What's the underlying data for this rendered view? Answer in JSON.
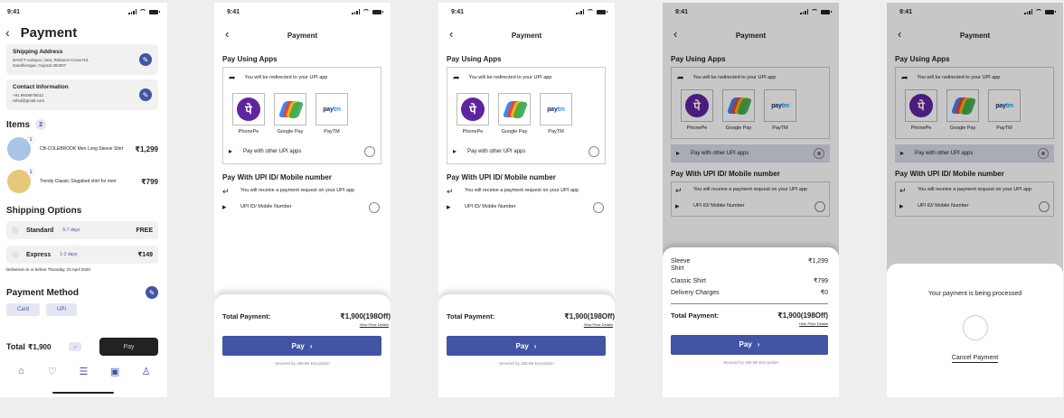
{
  "status_time": "9:41",
  "checkout": {
    "title": "Payment",
    "shipping_address": {
      "title": "Shipping Address",
      "line1": "DAIICT-campus, near, Reliance Cross Rd,",
      "line2": "Gandhinagar, Gujarat 382007"
    },
    "contact": {
      "title": "Contact Information",
      "phone": "+91 9648875612",
      "email": "rahul@gmail.com"
    },
    "items_label": "Items",
    "items_count": "2",
    "items": [
      {
        "qty": "1",
        "name": "CB-COLEBROOK Men Long Sleeve Shirt",
        "price": "₹1,299",
        "color": "#a9c4e4"
      },
      {
        "qty": "1",
        "name": "Trendy Classic Slugabed shirt for men",
        "price": "₹799",
        "color": "#e7c77a"
      }
    ],
    "shipping_label": "Shipping Options",
    "shipping_options": [
      {
        "name": "Standard",
        "days": "5-7 days",
        "price": "FREE"
      },
      {
        "name": "Express",
        "days": "1-2 days",
        "price": "₹149"
      }
    ],
    "delivery_note": "Delivered on or before Thursday, 23 April 2020",
    "payment_method_label": "Payment Method",
    "methods": [
      "Card",
      "UPI"
    ],
    "total_label": "Total",
    "total_value": "₹1,900",
    "pay_label": "Pay",
    "tabs": [
      "home-icon",
      "heart-icon",
      "list-icon",
      "bag-icon",
      "profile-icon"
    ]
  },
  "upi": {
    "title": "Payment",
    "pay_using_apps": "Pay Using Apps",
    "redirect_text": "You will be redirected to your UPI app",
    "apps": [
      {
        "name": "PhonePe",
        "icon": "phonepe-icon"
      },
      {
        "name": "Google Pay",
        "icon": "googlepay-icon"
      },
      {
        "name": "PayTM",
        "icon": "paytm-icon"
      }
    ],
    "paytm_logo_a": "pay",
    "paytm_logo_b": "tm",
    "phonepe_glyph": "पे",
    "other_apps": "Pay with other UPI apps",
    "upi_section": "Pay With UPI ID/ Mobile number",
    "upi_request": "You will receive a payment request on your UPI app",
    "upi_field": "UPI ID/ Mobile Number",
    "total_label": "Total Payment:",
    "total_value": "₹1,900(198Off)",
    "view_details": "View Price Details",
    "hide_details": "Hide Price Details",
    "pay_label": "Pay",
    "secured": "Secured by 256-Bit Encryption",
    "breakdown": [
      {
        "label": "Sleeve\nShirt",
        "value": "₹1,299"
      },
      {
        "label": "Classic Shirt",
        "value": "₹799"
      },
      {
        "label": "Delivery  Charges",
        "value": "₹0"
      }
    ],
    "processing": "Your payment is being processed",
    "cancel": "Cancel Payment"
  }
}
